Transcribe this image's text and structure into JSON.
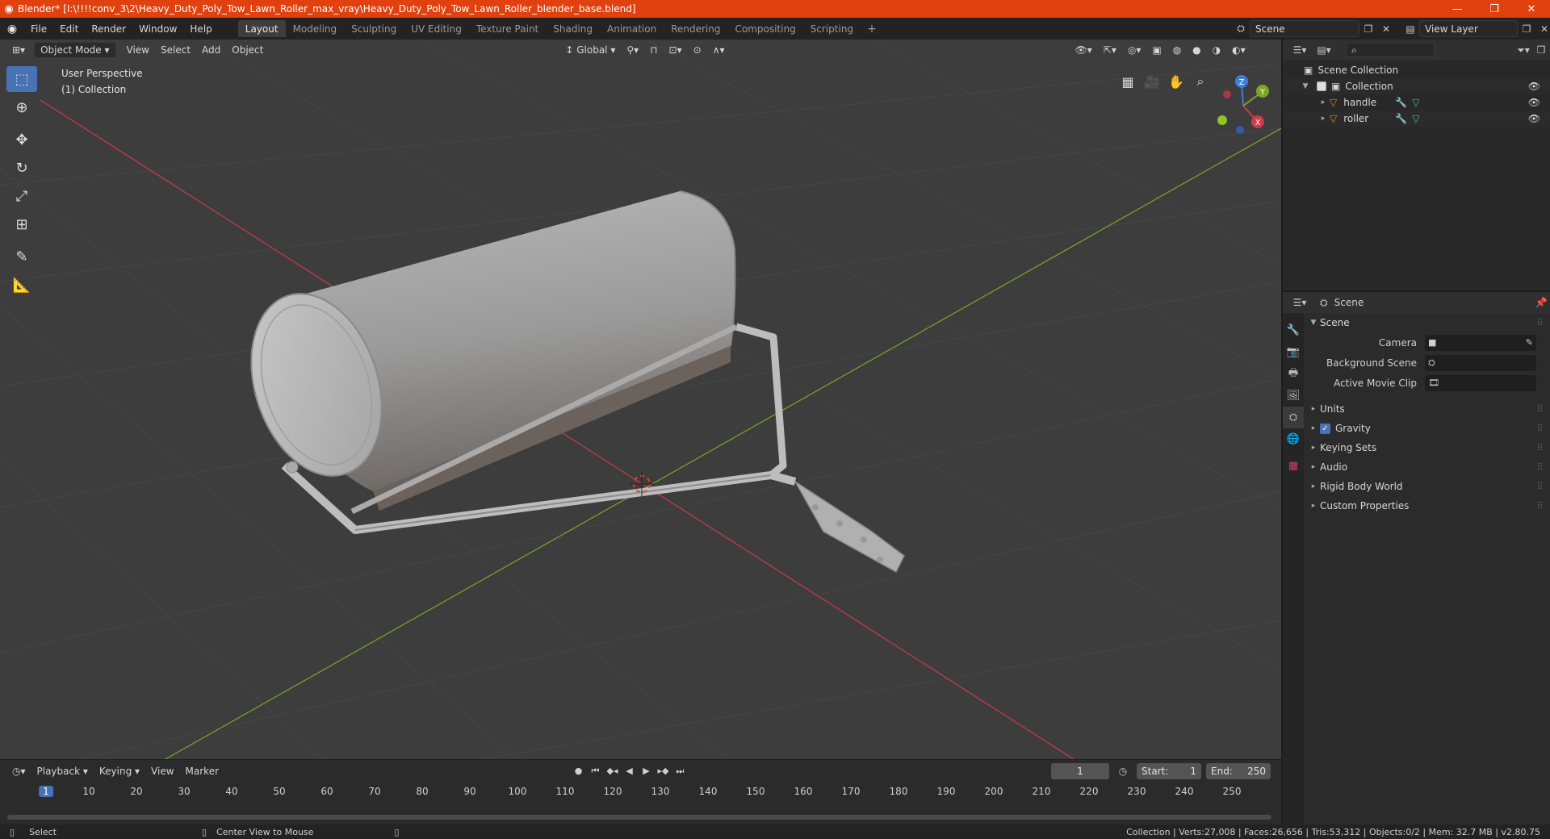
{
  "titlebar": {
    "title": "Blender* [I:\\!!!!conv_3\\2\\Heavy_Duty_Poly_Tow_Lawn_Roller_max_vray\\Heavy_Duty_Poly_Tow_Lawn_Roller_blender_base.blend]",
    "minimize": "—",
    "maximize": "❐",
    "close": "✕"
  },
  "menu": [
    "File",
    "Edit",
    "Render",
    "Window",
    "Help"
  ],
  "workspaces": [
    "Layout",
    "Modeling",
    "Sculpting",
    "UV Editing",
    "Texture Paint",
    "Shading",
    "Animation",
    "Rendering",
    "Compositing",
    "Scripting"
  ],
  "active_workspace": "Layout",
  "scene_name": "Scene",
  "view_layer": "View Layer",
  "viewport": {
    "mode": "Object Mode",
    "menus": [
      "View",
      "Select",
      "Add",
      "Object"
    ],
    "transform_orientation": "Global",
    "perspective_label": "User Perspective",
    "collection_label": "(1) Collection",
    "gizmo": {
      "x": "X",
      "y": "Y",
      "z": "Z"
    }
  },
  "timeline": {
    "menus": [
      "Playback",
      "Keying",
      "View",
      "Marker"
    ],
    "current_frame": "1",
    "start_label": "Start:",
    "start": "1",
    "end_label": "End:",
    "end": "250",
    "ruler": [
      "10",
      "20",
      "30",
      "40",
      "50",
      "60",
      "70",
      "80",
      "90",
      "100",
      "110",
      "120",
      "130",
      "140",
      "150",
      "160",
      "170",
      "180",
      "190",
      "200",
      "210",
      "220",
      "230",
      "240",
      "250"
    ]
  },
  "statusbar": {
    "select": "Select",
    "center_view": "Center View to Mouse",
    "stats": "Collection | Verts:27,008 | Faces:26,656 | Tris:53,312 | Objects:0/2 | Mem: 32.7 MB | v2.80.75"
  },
  "outliner": {
    "root": "Scene Collection",
    "collection": "Collection",
    "objects": [
      "handle",
      "roller"
    ]
  },
  "properties": {
    "header": "Scene",
    "section": "Scene",
    "fields": [
      {
        "label": "Camera"
      },
      {
        "label": "Background Scene"
      },
      {
        "label": "Active Movie Clip"
      }
    ],
    "subpanels": [
      "Units",
      "Gravity",
      "Keying Sets",
      "Audio",
      "Rigid Body World",
      "Custom Properties"
    ]
  },
  "colors": {
    "accent": "#4772b3",
    "titlebar": "#e0410f",
    "x_axis": "#cc3b4a",
    "y_axis": "#7fa623",
    "z_axis": "#3f7fd6"
  }
}
